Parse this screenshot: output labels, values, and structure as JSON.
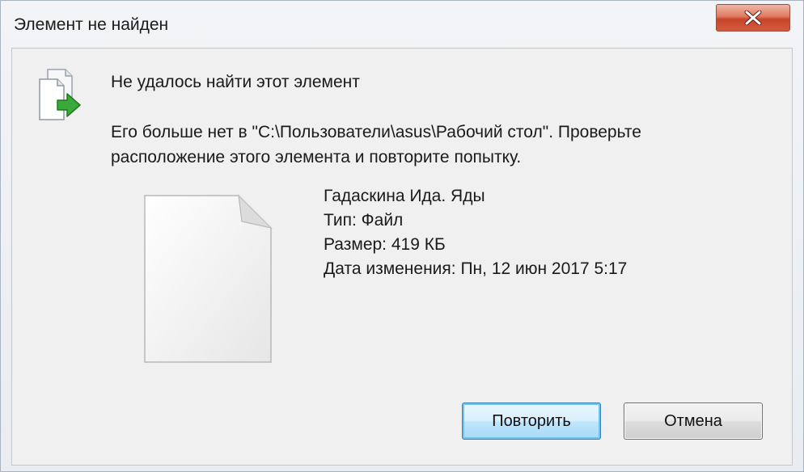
{
  "window": {
    "title": "Элемент не найден",
    "close_icon": "close-icon"
  },
  "dialog": {
    "heading": "Не удалось найти этот элемент",
    "message": "Его больше нет в \"C:\\Пользователи\\asus\\Рабочий стол\". Проверьте расположение этого элемента и повторите попытку.",
    "header_icon": "file-copy-arrow-icon",
    "file_icon": "blank-file-icon"
  },
  "file": {
    "name": "Гадаскина Ида. Яды",
    "type": "Тип: Файл",
    "size": "Размер: 419 КБ",
    "modified": "Дата изменения: Пн, 12 июн 2017 5:17"
  },
  "buttons": {
    "retry": "Повторить",
    "cancel": "Отмена"
  },
  "colors": {
    "close_button": "#d35a3b",
    "default_button_border": "#3c7fb1",
    "arrow_green": "#3aa83a"
  }
}
